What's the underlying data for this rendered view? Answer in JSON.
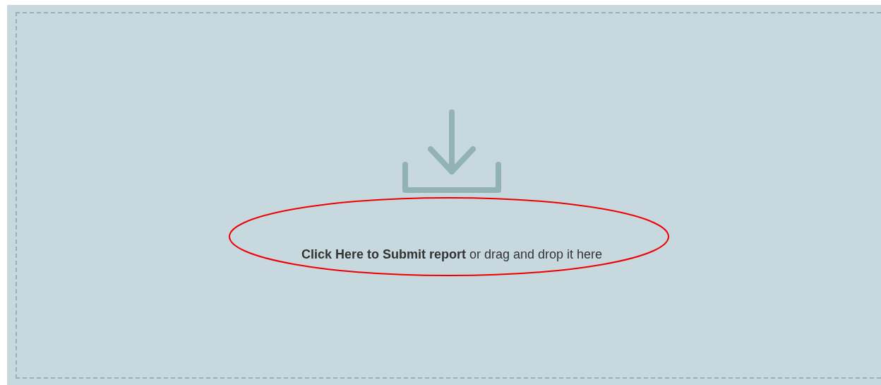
{
  "dropzone": {
    "instruction": "**Click Here to Submit report** or drag and drop it here"
  },
  "highlight": {
    "kind": "ellipse"
  }
}
